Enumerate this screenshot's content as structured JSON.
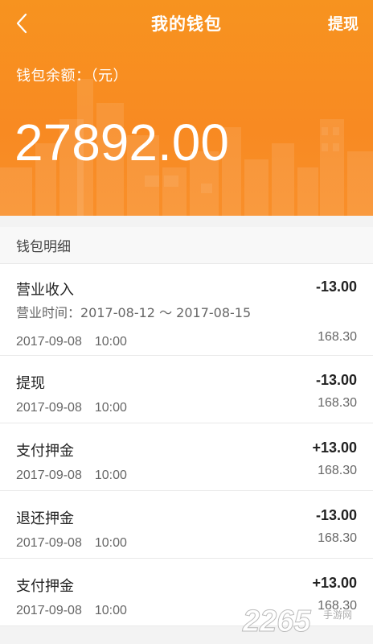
{
  "nav": {
    "title": "我的钱包",
    "withdraw_label": "提现",
    "back_icon": "chevron-left-icon"
  },
  "wallet": {
    "balance_label": "钱包余额：（元）",
    "balance": "27892.00"
  },
  "details": {
    "section_title": "钱包明细",
    "items": [
      {
        "title": "营业收入",
        "amount": "-13.00",
        "subtitle": "营业时间：2017-08-12 ～ 2017-08-15",
        "date": "2017-09-08　10:00",
        "balance": "168.30"
      },
      {
        "title": "提现",
        "amount": "-13.00",
        "date": "2017-09-08　10:00",
        "balance": "168.30"
      },
      {
        "title": "支付押金",
        "amount": "+13.00",
        "date": "2017-09-08　10:00",
        "balance": "168.30"
      },
      {
        "title": "退还押金",
        "amount": "-13.00",
        "date": "2017-09-08　10:00",
        "balance": "168.30"
      },
      {
        "title": "支付押金",
        "amount": "+13.00",
        "date": "2017-09-08　10:00",
        "balance": "168.30"
      }
    ]
  },
  "watermark": {
    "brand": "2265",
    "site": "手游网"
  },
  "colors": {
    "header_orange": "#f7931f",
    "text_dark": "#222222",
    "text_gray": "#666666"
  }
}
